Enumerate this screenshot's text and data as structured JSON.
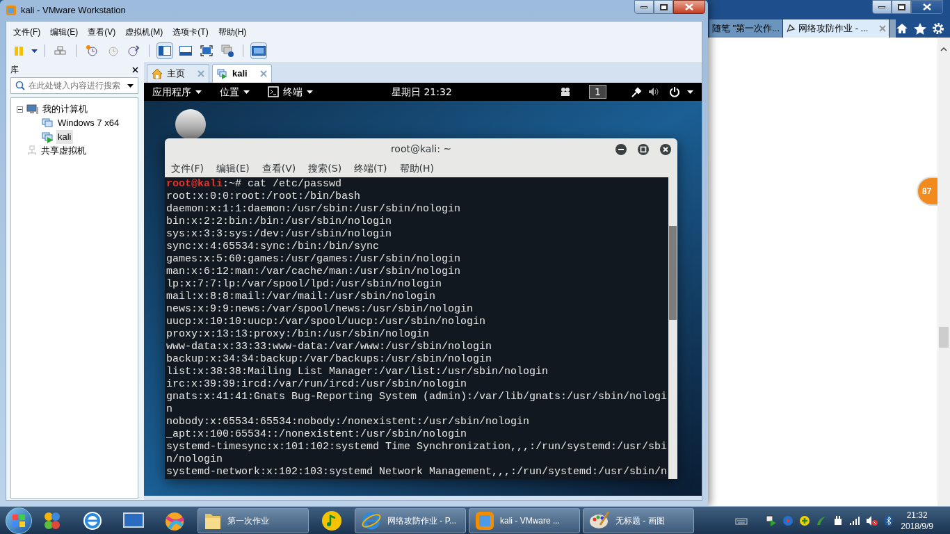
{
  "browser": {
    "tabs": [
      {
        "label": "随笔 \"第一次作...",
        "selected": false
      },
      {
        "label": "网络攻防作业 - ...",
        "selected": true
      }
    ],
    "badge": "87"
  },
  "vmware": {
    "title": "kali - VMware Workstation",
    "menu": [
      "文件(F)",
      "编辑(E)",
      "查看(V)",
      "虚拟机(M)",
      "选项卡(T)",
      "帮助(H)"
    ],
    "library": {
      "title": "库",
      "search": {
        "placeholder": "在此处键入内容进行搜索"
      },
      "tree": [
        {
          "label": "我的计算机",
          "expanded": true,
          "selected": false,
          "children": [
            {
              "label": "Windows 7 x64",
              "selected": false,
              "running": false
            },
            {
              "label": "kali",
              "selected": true,
              "running": true
            }
          ]
        },
        {
          "label": "共享虚拟机",
          "selected": false
        }
      ]
    },
    "tabs": [
      {
        "label": "主页",
        "kind": "home",
        "selected": false
      },
      {
        "label": "kali",
        "kind": "vm",
        "selected": true
      }
    ]
  },
  "kali": {
    "top_bar": {
      "menus": [
        {
          "label": "应用程序",
          "kind": "plain"
        },
        {
          "label": "位置",
          "kind": "plain"
        },
        {
          "label": "终端",
          "kind": "terminal"
        }
      ],
      "clock": "星期日 21:32",
      "workspace": "1"
    },
    "terminal": {
      "title": "root@kali: ~",
      "menu": [
        "文件(F)",
        "编辑(E)",
        "查看(V)",
        "搜索(S)",
        "终端(T)",
        "帮助(H)"
      ],
      "prompt": {
        "user": "root@kali",
        "rest": ":~# cat /etc/passwd"
      },
      "lines": [
        "root:x:0:0:root:/root:/bin/bash",
        "daemon:x:1:1:daemon:/usr/sbin:/usr/sbin/nologin",
        "bin:x:2:2:bin:/bin:/usr/sbin/nologin",
        "sys:x:3:3:sys:/dev:/usr/sbin/nologin",
        "sync:x:4:65534:sync:/bin:/bin/sync",
        "games:x:5:60:games:/usr/games:/usr/sbin/nologin",
        "man:x:6:12:man:/var/cache/man:/usr/sbin/nologin",
        "lp:x:7:7:lp:/var/spool/lpd:/usr/sbin/nologin",
        "mail:x:8:8:mail:/var/mail:/usr/sbin/nologin",
        "news:x:9:9:news:/var/spool/news:/usr/sbin/nologin",
        "uucp:x:10:10:uucp:/var/spool/uucp:/usr/sbin/nologin",
        "proxy:x:13:13:proxy:/bin:/usr/sbin/nologin",
        "www-data:x:33:33:www-data:/var/www:/usr/sbin/nologin",
        "backup:x:34:34:backup:/var/backups:/usr/sbin/nologin",
        "list:x:38:38:Mailing List Manager:/var/list:/usr/sbin/nologin",
        "irc:x:39:39:ircd:/var/run/ircd:/usr/sbin/nologin",
        "gnats:x:41:41:Gnats Bug-Reporting System (admin):/var/lib/gnats:/usr/sbin/nologi",
        "n",
        "nobody:x:65534:65534:nobody:/nonexistent:/usr/sbin/nologin",
        "_apt:x:100:65534::/nonexistent:/usr/sbin/nologin",
        "systemd-timesync:x:101:102:systemd Time Synchronization,,,:/run/systemd:/usr/sbi",
        "n/nologin",
        "systemd-network:x:102:103:systemd Network Management,,,:/run/systemd:/usr/sbin/n"
      ]
    }
  },
  "taskbar": {
    "tasks": [
      {
        "kind": "folder",
        "label": "第一次作业"
      },
      {
        "kind": "music"
      },
      {
        "kind": "ie",
        "label": "网络攻防作业 - P..."
      },
      {
        "kind": "vmware",
        "label": "kali - VMware ..."
      },
      {
        "kind": "paint",
        "label": "无标题 - 画图"
      }
    ],
    "time": "21:32",
    "date": "2018/9/9"
  }
}
